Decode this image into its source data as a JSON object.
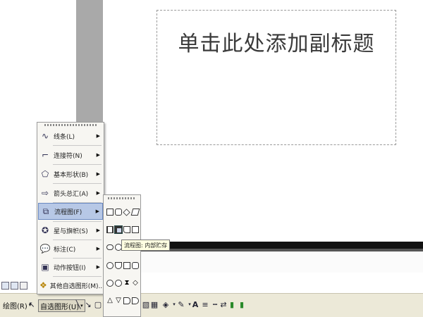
{
  "slide": {
    "subtitle_placeholder": "单击此处添加副标题"
  },
  "menu": {
    "items": [
      {
        "label": "线条(L)",
        "icon": "line-icon",
        "has_submenu": true
      },
      {
        "label": "连接符(N)",
        "icon": "connector-icon",
        "has_submenu": true
      },
      {
        "label": "基本形状(B)",
        "icon": "basic-shapes-icon",
        "has_submenu": true
      },
      {
        "label": "箭头总汇(A)",
        "icon": "block-arrows-icon",
        "has_submenu": true
      },
      {
        "label": "流程图(F)",
        "icon": "flowchart-icon",
        "has_submenu": true,
        "highlighted": true
      },
      {
        "label": "星与旗帜(S)",
        "icon": "stars-banners-icon",
        "has_submenu": true
      },
      {
        "label": "标注(C)",
        "icon": "callouts-icon",
        "has_submenu": true
      },
      {
        "label": "动作按钮(I)",
        "icon": "action-buttons-icon",
        "has_submenu": true
      },
      {
        "label": "其他自选图形(M)...",
        "icon": "more-autoshapes-icon",
        "has_submenu": false
      }
    ]
  },
  "tooltip": {
    "text": "流程图: 内部贮存"
  },
  "toolbar": {
    "draw_label": "绘图(R)",
    "autoshapes_label": "自选图形(U)"
  },
  "colors": {
    "menu_highlight": "#b7c8e6",
    "toolbar_bg": "#ece9d8",
    "gray_panel": "#a9a9a9"
  }
}
